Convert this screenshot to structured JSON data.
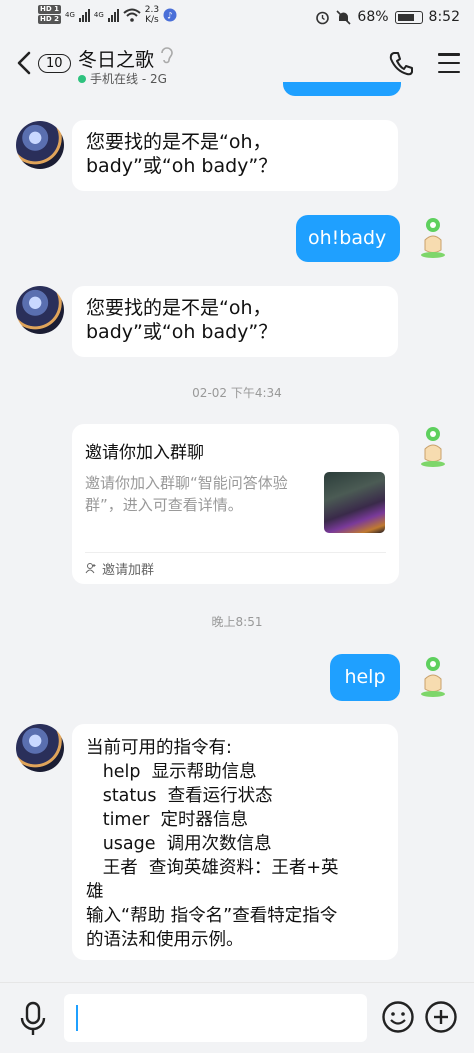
{
  "status_bar": {
    "hd1": "HD 1",
    "hd2": "HD 2",
    "net1": "4G",
    "net2": "4G",
    "speed_value": "2.3",
    "speed_unit": "K/s",
    "battery": "68%",
    "time": "8:52"
  },
  "header": {
    "back_icon": "chevron-left-icon",
    "unread_count": "10",
    "title": "冬日之歌",
    "online_status": "手机在线 - 2G"
  },
  "messages": [
    {
      "sender": "bot",
      "text": "您要找的是不是“oh，\nbady”或“oh bady”？"
    },
    {
      "sender": "me",
      "text": "oh!bady"
    },
    {
      "sender": "bot",
      "text": "您要找的是不是“oh，\nbady”或“oh bady”？"
    }
  ],
  "timestamp1": "02-02 下午4:34",
  "invite_card": {
    "title": "邀请你加入群聊",
    "description": "邀请你加入群聊“智能问答体验群”，进入可查看详情。",
    "footer": "邀请加群"
  },
  "timestamp2": "晚上8:51",
  "help_message": {
    "sender": "me",
    "text": "help"
  },
  "commands_reply": {
    "sender": "bot",
    "text": "当前可用的指令有:\n   help  显示帮助信息\n   status  查看运行状态\n   timer  定时器信息\n   usage  调用次数信息\n   王者  查询英雄资料：王者+英\n雄\n输入“帮助 指令名”查看特定指令\n的语法和使用示例。"
  },
  "input_bar": {
    "input_value": "",
    "icons": [
      "microphone-icon",
      "emoji-icon",
      "plus-icon"
    ]
  },
  "colors": {
    "accent": "#1fa0ff",
    "online_dot": "#2ec27e",
    "background": "#f2f3f5"
  }
}
